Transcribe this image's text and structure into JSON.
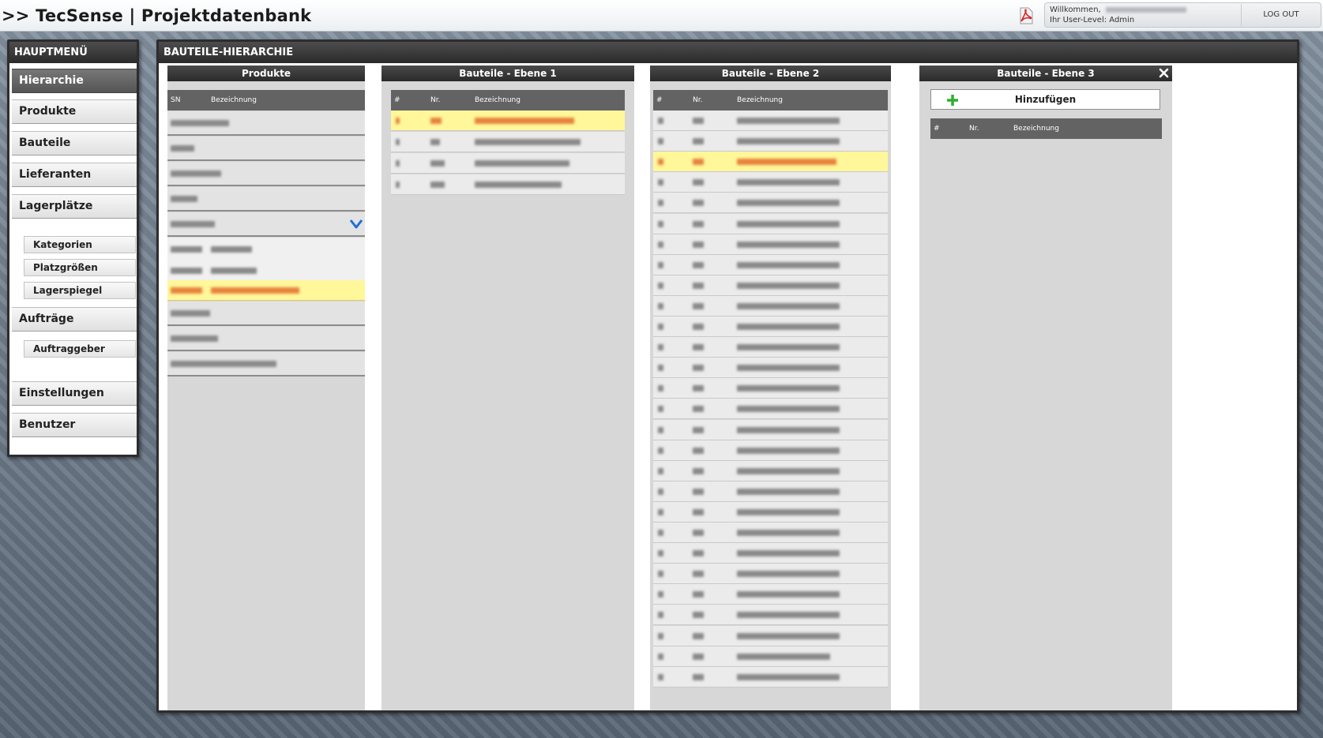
{
  "header": {
    "title": ">> TecSense | Projektdatenbank",
    "welcome": "Willkommen,",
    "user_level": "Ihr User-Level: Admin",
    "logout": "LOG OUT",
    "pdf_icon": "pdf-icon"
  },
  "menu": {
    "title": "HAUPTMENÜ",
    "items": [
      {
        "label": "Hierarchie"
      },
      {
        "label": "Produkte"
      },
      {
        "label": "Bauteile"
      },
      {
        "label": "Lieferanten"
      },
      {
        "label": "Lagerplätze"
      },
      {
        "label": "Aufträge"
      },
      {
        "label": "Einstellungen"
      },
      {
        "label": "Benutzer"
      }
    ],
    "lager_sub": [
      {
        "label": "Kategorien"
      },
      {
        "label": "Platzgrößen"
      },
      {
        "label": "Lagerspiegel"
      }
    ],
    "auftraege_sub": [
      {
        "label": "Auftraggeber"
      }
    ]
  },
  "main": {
    "title": "BAUTEILE-HIERARCHIE",
    "products": {
      "title": "Produkte",
      "columns": [
        "SN",
        "Bezeichnung"
      ]
    },
    "level1": {
      "title": "Bauteile - Ebene 1",
      "columns": [
        "#",
        "Nr.",
        "Bezeichnung"
      ]
    },
    "level2": {
      "title": "Bauteile - Ebene 2",
      "columns": [
        "#",
        "Nr.",
        "Bezeichnung"
      ]
    },
    "level3": {
      "title": "Bauteile - Ebene 3",
      "add_label": "Hinzufügen",
      "columns": [
        "#",
        "Nr.",
        "Bezeichnung"
      ]
    }
  },
  "colors": {
    "highlight": "#fff79a",
    "header_dark": "#2a2a2a",
    "table_head": "#636363"
  }
}
